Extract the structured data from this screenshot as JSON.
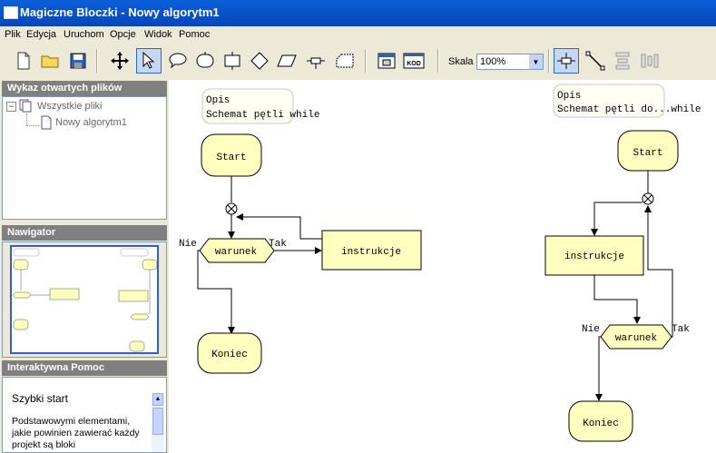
{
  "window": {
    "title": "Magiczne Bloczki - Nowy algorytm1"
  },
  "menu": [
    "Plik",
    "Edycja",
    "Uruchom",
    "Opcje",
    "Widok",
    "Pomoc"
  ],
  "toolbar": {
    "zoom_label": "Skala",
    "zoom_value": "100%",
    "button_labels": {
      "code": "KOD"
    }
  },
  "sidebar": {
    "files_panel": {
      "title": "Wykaz otwartych plików",
      "root": "Wszystkie pliki",
      "child": "Nowy algorytm1"
    },
    "navigator_panel": {
      "title": "Nawigator"
    },
    "help_panel": {
      "title": "Interaktywna Pomoc",
      "heading": "Szybki start",
      "text": "Podstawowymi elementami, jakie powinien zawierać każdy projekt są bloki"
    }
  },
  "canvas": {
    "left_diagram": {
      "desc": [
        "Opis",
        "Schemat pętli while"
      ],
      "start": "Start",
      "condition": "warunek",
      "no_label": "Nie",
      "yes_label": "Tak",
      "instructions": "instrukcje",
      "end": "Koniec"
    },
    "right_diagram": {
      "desc": [
        "Opis",
        "Schemat pętli do...while"
      ],
      "start": "Start",
      "instructions": "instrukcje",
      "condition": "warunek",
      "no_label": "Nie",
      "yes_label": "Tak",
      "end": "Koniec"
    }
  },
  "colors": {
    "block_fill": "#ffffc0",
    "desc_fill": "#fffff4",
    "titlebar": "#0a5fd8",
    "panel_header": "#808080"
  }
}
